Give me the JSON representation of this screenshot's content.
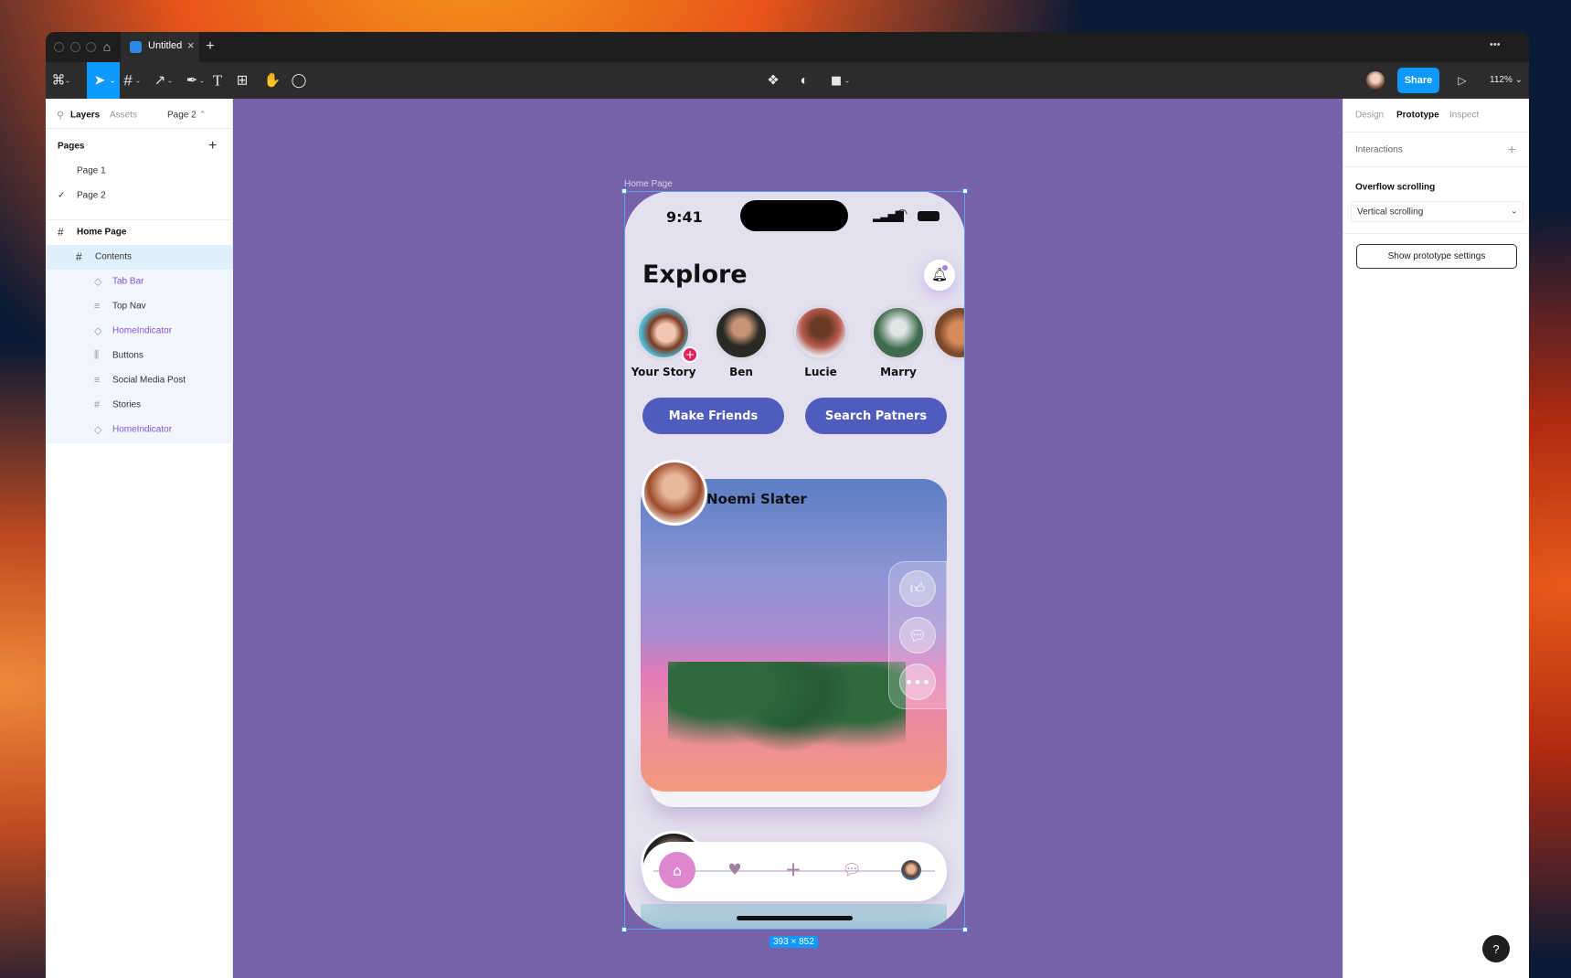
{
  "window": {
    "tab_title": "Untitled",
    "more_label": "•••"
  },
  "toolbar": {
    "share_label": "Share",
    "zoom_level": "112%"
  },
  "left_panel": {
    "tabs": [
      "Layers",
      "Assets"
    ],
    "page_selector": "Page 2",
    "pages_heading": "Pages",
    "pages": [
      {
        "label": "Page 1",
        "selected": false
      },
      {
        "label": "Page 2",
        "selected": true
      }
    ],
    "layers": [
      {
        "label": "Home Page",
        "icon": "frame-icon"
      },
      {
        "label": "Contents",
        "icon": "frame-icon"
      },
      {
        "label": "Tab Bar",
        "icon": "component-instance-icon",
        "component": true
      },
      {
        "label": "Top Nav",
        "icon": "auto-layout-vertical-icon"
      },
      {
        "label": "HomeIndicator",
        "icon": "component-instance-icon",
        "component": true
      },
      {
        "label": "Buttons",
        "icon": "auto-layout-horizontal-icon"
      },
      {
        "label": "Social Media Post",
        "icon": "auto-layout-vertical-icon"
      },
      {
        "label": "Stories",
        "icon": "frame-icon"
      },
      {
        "label": "HomeIndicator",
        "icon": "component-instance-icon",
        "component": true
      }
    ]
  },
  "right_panel": {
    "tabs": [
      "Design",
      "Prototype",
      "Inspect"
    ],
    "active_tab": "Prototype",
    "interactions_label": "Interactions",
    "overflow_heading": "Overflow scrolling",
    "overflow_value": "Vertical scrolling",
    "settings_button": "Show prototype settings"
  },
  "canvas": {
    "frame_label": "Home Page",
    "frame_size": "393 × 852",
    "background": "#7762aa"
  },
  "phone": {
    "time": "9:41",
    "title": "Explore",
    "stories": [
      "Your Story",
      "Ben",
      "Lucie",
      "Marry"
    ],
    "buttons": [
      "Make Friends",
      "Search Patners"
    ],
    "post_author": "Noemi Slater",
    "accent": "#4f5bbd"
  },
  "help_label": "?"
}
